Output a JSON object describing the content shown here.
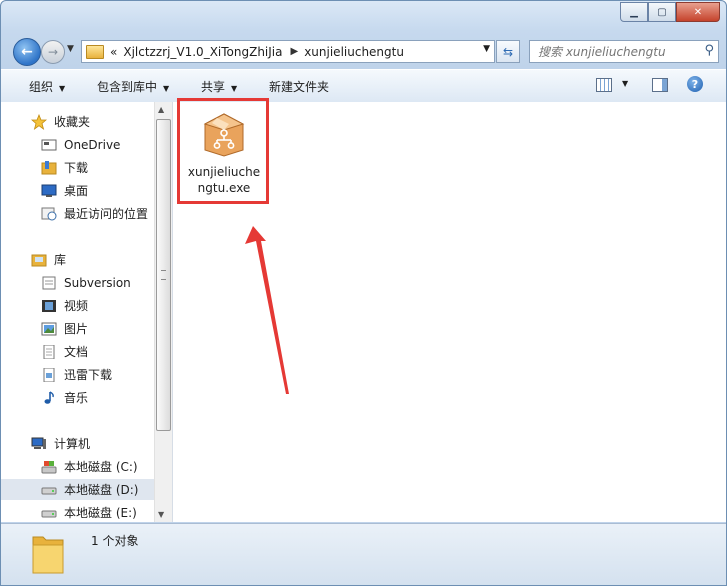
{
  "window": {
    "controls": [
      "minimize",
      "maximize",
      "close"
    ]
  },
  "address": {
    "overflow": "«",
    "crumbs": [
      "Xjlctzzrj_V1.0_XiTongZhiJia",
      "xunjieliuchengtu"
    ]
  },
  "search": {
    "placeholder": "搜索 xunjieliuchengtu"
  },
  "toolbar": {
    "organize": "组织",
    "include_library": "包含到库中",
    "share": "共享",
    "new_folder": "新建文件夹"
  },
  "nav": {
    "favorites": "收藏夹",
    "onedrive": "OneDrive",
    "downloads": "下载",
    "desktop": "桌面",
    "recent": "最近访问的位置",
    "libraries": "库",
    "subversion": "Subversion",
    "videos": "视频",
    "pictures": "图片",
    "documents": "文档",
    "thunder": "迅雷下载",
    "music": "音乐",
    "computer": "计算机",
    "drive_c": "本地磁盘 (C:)",
    "drive_d": "本地磁盘 (D:)",
    "drive_e": "本地磁盘 (E:)"
  },
  "files": [
    {
      "name": "xunjieliuchengtu.exe",
      "icon": "package-flowchart-icon"
    }
  ],
  "status": {
    "count": "1 个对象"
  },
  "colors": {
    "highlight": "#e53935",
    "accent": "#2f74c8"
  }
}
